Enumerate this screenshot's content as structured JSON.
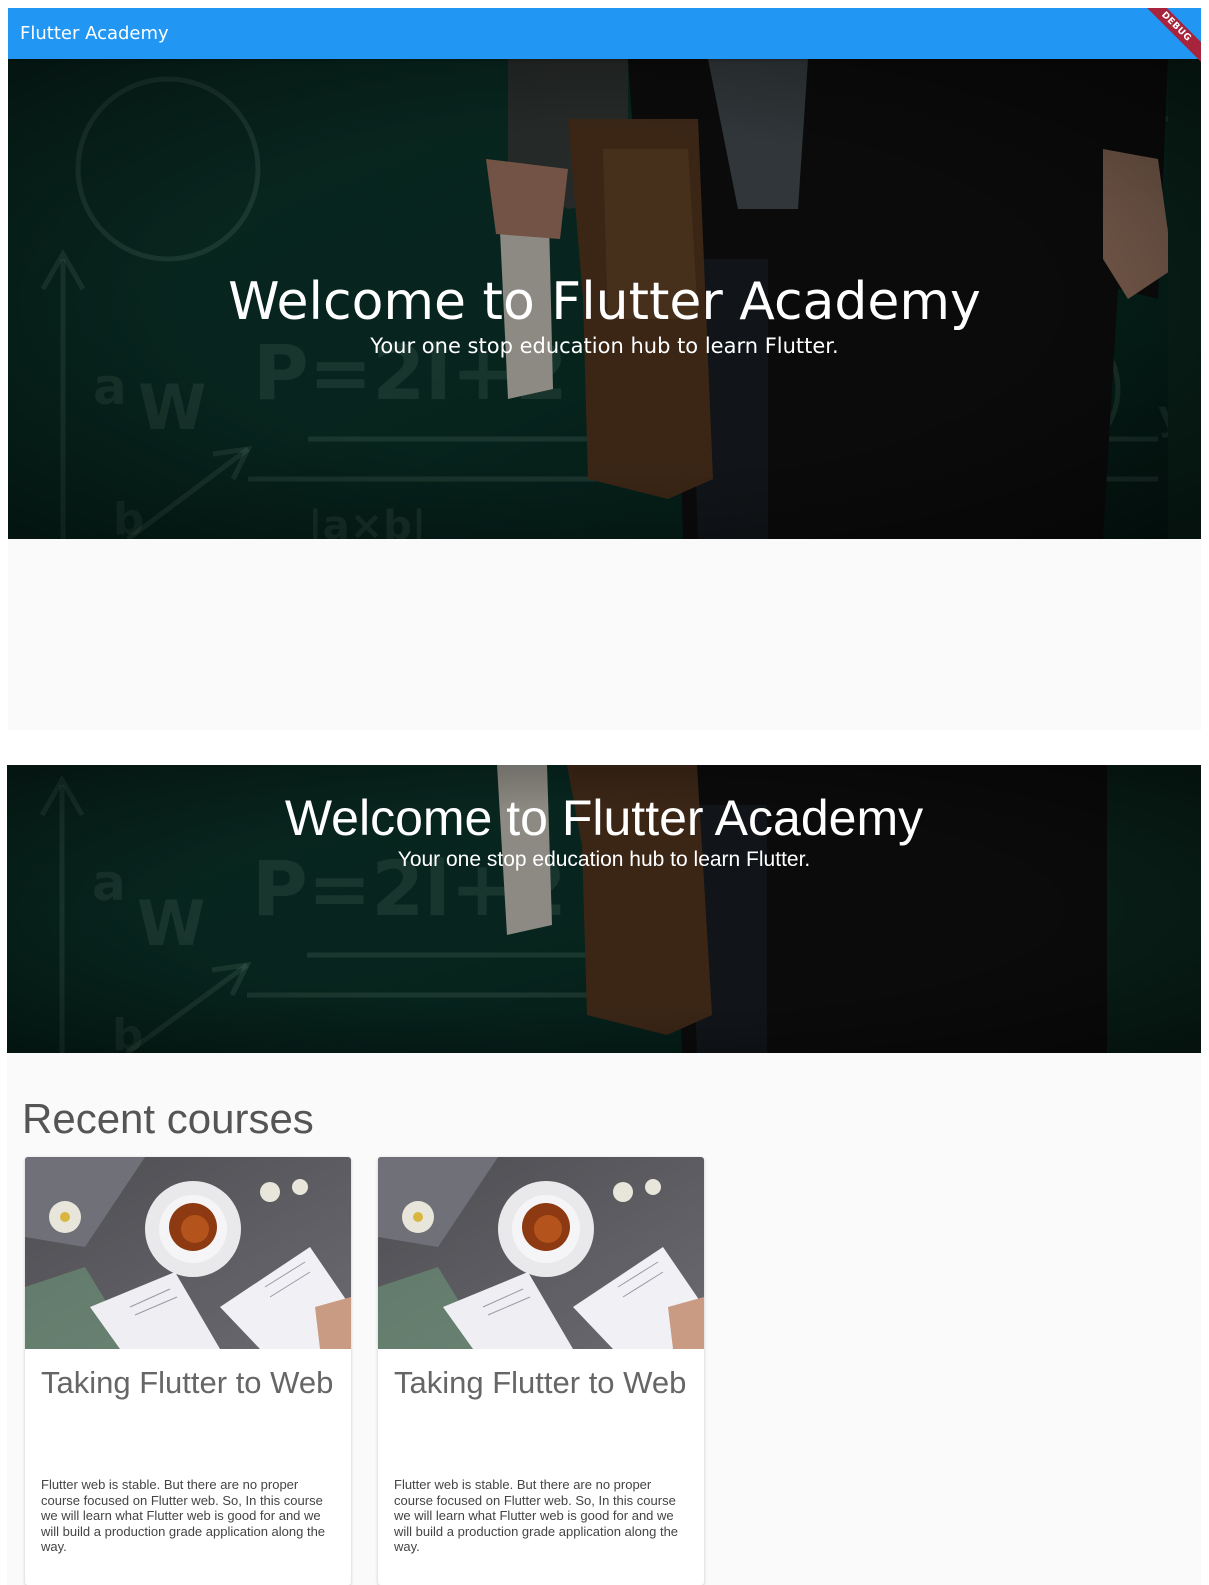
{
  "app": {
    "title": "Flutter Academy",
    "debug_banner": "DEBUG"
  },
  "hero": {
    "title": "Welcome to Flutter Academy",
    "subtitle": "Your one stop education hub to learn Flutter."
  },
  "section": {
    "title": "Recent courses"
  },
  "courses": [
    {
      "title": "Taking Flutter to Web",
      "description": "Flutter web is stable. But there are no proper course focused on Flutter web. So, In this course we will learn what Flutter web is good for and we will build a production grade application along the way."
    },
    {
      "title": "Taking Flutter to Web",
      "description": "Flutter web is stable. But there are no proper course focused on Flutter web. So, In this course we will learn what Flutter web is good for and we will build a production grade application along the way."
    }
  ],
  "colors": {
    "appbar": "#2196f3",
    "debug_banner": "#a8233c",
    "hero_overlay": "#0c2a23"
  },
  "icons": {
    "hero_image": "chalkboard-person-image",
    "course_image": "tea-cup-books-image"
  }
}
